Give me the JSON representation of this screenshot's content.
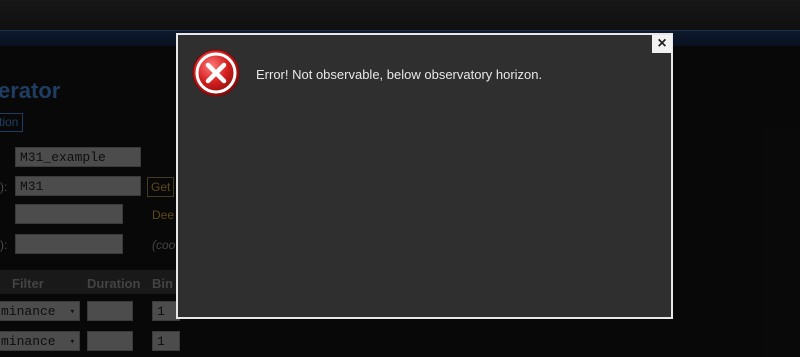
{
  "background": {
    "title": "erator",
    "link": "tion",
    "rows": [
      {
        "label": "",
        "value": "M31_example"
      },
      {
        "label": "):",
        "value": "M31",
        "button": "Get"
      },
      {
        "label": "",
        "value": "",
        "note": "Dee"
      },
      {
        "label": "):",
        "value": "",
        "note": "(coo"
      }
    ],
    "table": {
      "headers": [
        "Filter",
        "Duration",
        "Bin"
      ],
      "rows": [
        {
          "filter": "minance",
          "bin": "1"
        },
        {
          "filter": "minance",
          "bin": "1"
        }
      ]
    }
  },
  "dialog": {
    "message": "Error! Not observable, below observatory horizon.",
    "close_label": "×",
    "icon": "error-icon"
  },
  "colors": {
    "accent_blue": "#3a6fb3",
    "gold": "#a8852e",
    "dialog_bg": "#2f2f2f",
    "error_red": "#d41f1f"
  }
}
